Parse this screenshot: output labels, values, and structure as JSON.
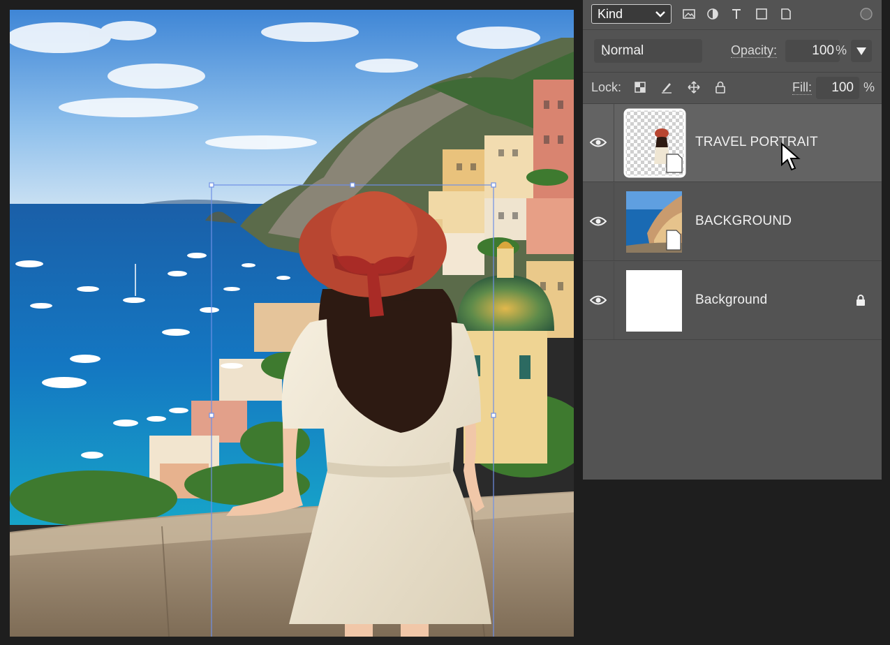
{
  "canvas": {
    "image_alt": "Woman in red sun hat and white dress overlooking coastal village and sea",
    "transform_box": {
      "active": true
    }
  },
  "layers_panel": {
    "filter": {
      "kind_label": "Kind",
      "icons": [
        "image-filter-icon",
        "adjustment-filter-icon",
        "type-filter-icon",
        "shape-filter-icon",
        "smart-object-filter-icon",
        "filter-toggle-icon"
      ]
    },
    "blend_mode": "Normal",
    "opacity_label": "Opacity:",
    "opacity_value": "100",
    "opacity_unit": "%",
    "lock_label": "Lock:",
    "lock_icons": [
      "lock-transparent-pixels-icon",
      "lock-image-pixels-icon",
      "lock-position-icon",
      "lock-all-icon"
    ],
    "fill_label": "Fill:",
    "fill_value": "100",
    "fill_unit": "%",
    "layers": [
      {
        "name": "TRAVEL PORTRAIT",
        "visible": true,
        "selected": true,
        "thumb": "transparent-portrait"
      },
      {
        "name": "BACKGROUND",
        "visible": true,
        "selected": false,
        "thumb": "scene"
      },
      {
        "name": "Background",
        "visible": true,
        "selected": false,
        "thumb": "white",
        "locked": true
      }
    ]
  },
  "colors": {
    "panel_bg": "#535353",
    "selected_row": "#636363",
    "transform_line": "#6f8fe6"
  }
}
